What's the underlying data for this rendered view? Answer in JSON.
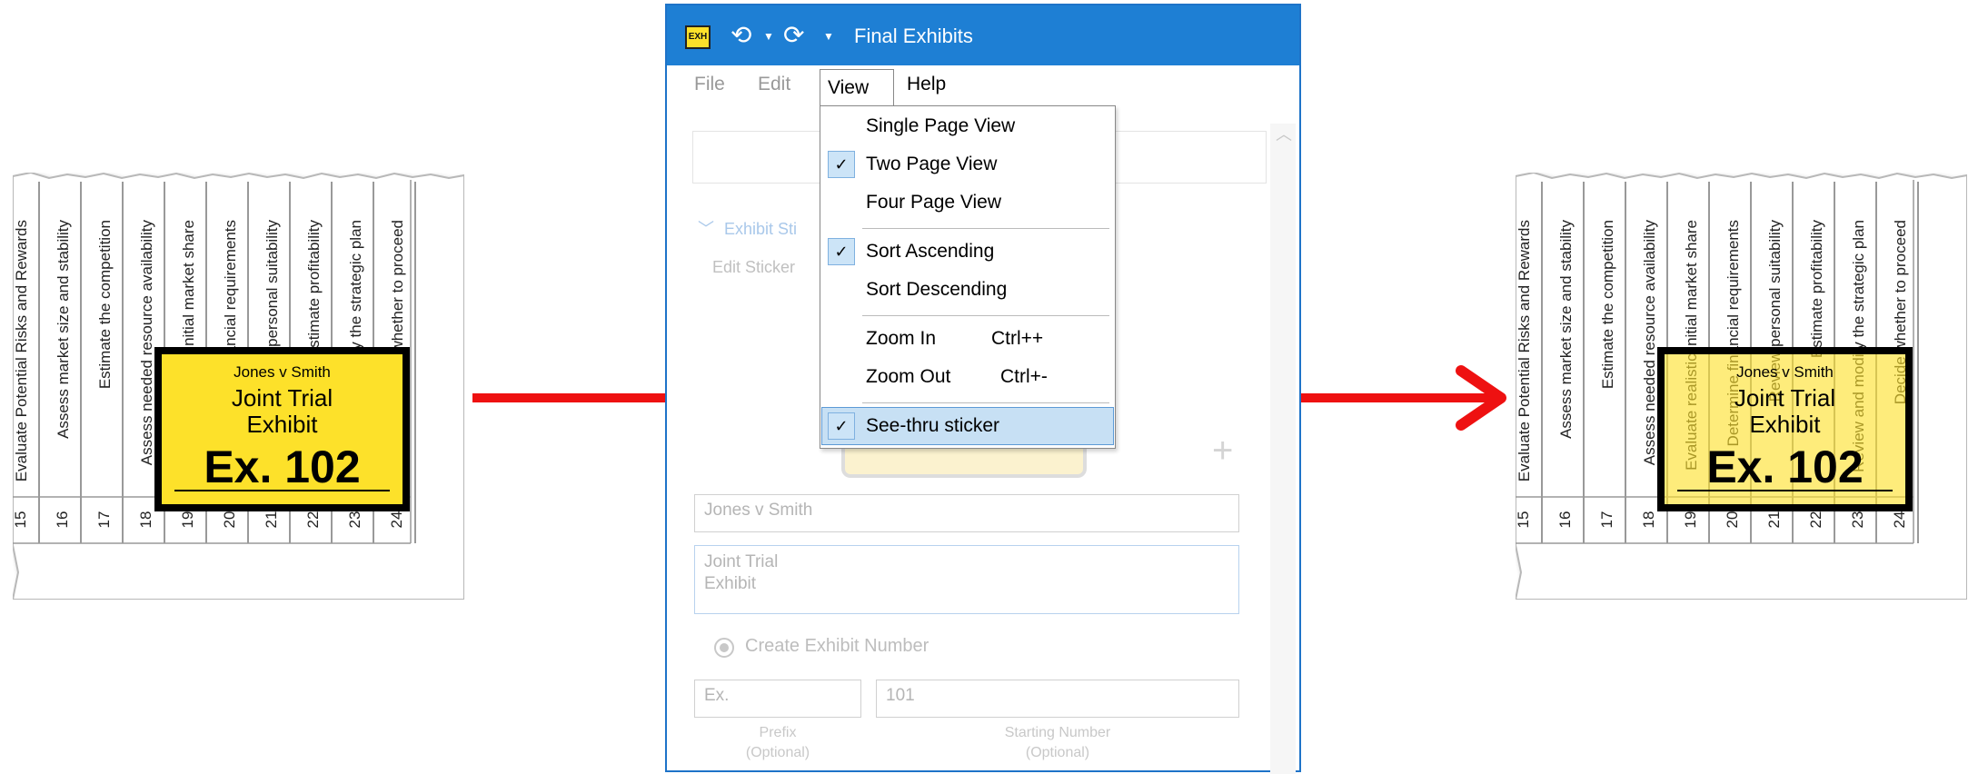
{
  "window": {
    "title": "Final Exhibits",
    "app_icon_text": "EXH",
    "undo_icon": "undo-icon",
    "redo_icon": "redo-icon"
  },
  "menubar": [
    "File",
    "Edit",
    "View",
    "Help"
  ],
  "view_menu": {
    "items": [
      {
        "label": "Single Page View",
        "checked": false
      },
      {
        "label": "Two Page View",
        "checked": true
      },
      {
        "label": "Four Page View",
        "checked": false
      },
      {
        "label": "Sort Ascending",
        "checked": true
      },
      {
        "label": "Sort Descending",
        "checked": false
      },
      {
        "label": "Zoom In",
        "shortcut": "Ctrl++",
        "checked": false
      },
      {
        "label": "Zoom Out",
        "shortcut": "Ctrl+-",
        "checked": false
      },
      {
        "label": "See-thru sticker",
        "checked": true,
        "highlighted": true
      }
    ]
  },
  "panel": {
    "section_title": "Exhibit Sti",
    "edit_label": "Edit Sticker",
    "case_field": "Jones v Smith",
    "title_field": "Joint Trial\nExhibit",
    "radio_label": "Create Exhibit Number",
    "prefix_value": "Ex.",
    "start_value": "101",
    "prefix_caption": "Prefix\n(Optional)",
    "start_caption": "Starting Number\n(Optional)"
  },
  "document": {
    "rows": [
      {
        "num": "15",
        "text": "Evaluate Potential Risks and Rewards"
      },
      {
        "num": "16",
        "text": "Assess market size and stability"
      },
      {
        "num": "17",
        "text": "Estimate the competition"
      },
      {
        "num": "18",
        "text": "Assess needed resource availability"
      },
      {
        "num": "19",
        "text": "Evaluate realistic initial market share"
      },
      {
        "num": "20",
        "text": "Determine financial requirements"
      },
      {
        "num": "21",
        "text": "Review personal suitability"
      },
      {
        "num": "22",
        "text": "Estimate profitability"
      },
      {
        "num": "23",
        "text": "Review and modify the strategic plan"
      },
      {
        "num": "24",
        "text": "Decide whether to proceed"
      }
    ]
  },
  "sticker": {
    "case": "Jones v Smith",
    "title_line1": "Joint Trial",
    "title_line2": "Exhibit",
    "number": "Ex. 102"
  },
  "colors": {
    "titlebar": "#1e7fd4",
    "sticker_yellow": "#fde12a",
    "arrow_red": "#ee1111",
    "menu_highlight": "#c7e0f4"
  }
}
